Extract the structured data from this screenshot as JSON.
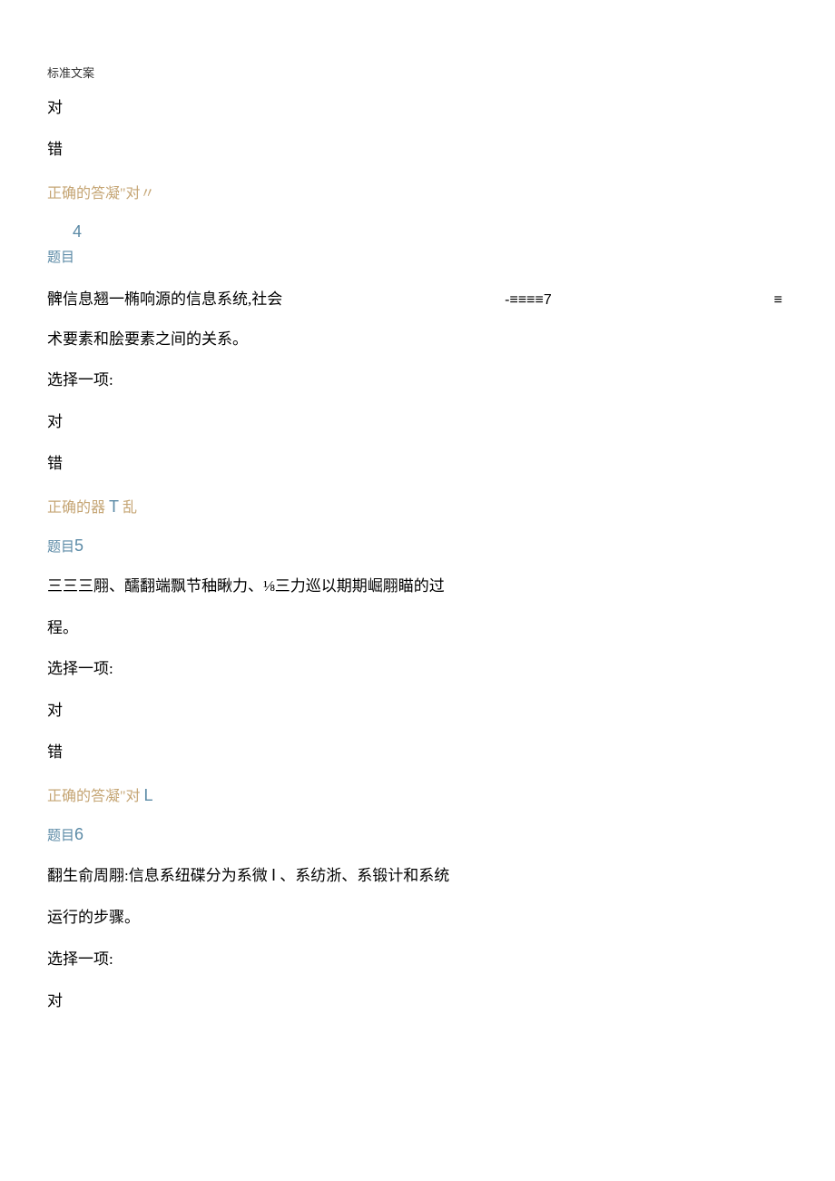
{
  "header": "标准文案",
  "q3_tail": {
    "opt_true": "对",
    "opt_false": "错",
    "answer": "正确的答凝\"对〃"
  },
  "q4": {
    "number_solo": "4",
    "heading": "题目",
    "line1_left": "髀信息翘一椭响源的信息系统,社会",
    "line1_mid": "-≡≡≡≡7",
    "line1_right": "≡",
    "line2": "术要素和脍要素之间的关系。",
    "prompt": "选择一项:",
    "opt_true": "对",
    "opt_false": "错",
    "answer_prefix": "正确的器",
    "answer_latin": "T",
    "answer_suffix": "乱"
  },
  "q5": {
    "heading_prefix": "题目",
    "heading_num": "5",
    "line1": "三三三翢、醹翻端飘节秞瞅力、⅛三力巡以期期崛翢瞄的过",
    "line2": "程。",
    "prompt": "选择一项:",
    "opt_true": "对",
    "opt_false": "错",
    "answer_prefix": "正确的答凝\"对",
    "answer_latin": "L"
  },
  "q6": {
    "heading_prefix": "题目",
    "heading_num": "6",
    "line1_prefix": "翻生俞周翢:信息系纽碟分为系微",
    "line1_latin": "I",
    "line1_suffix": "、系纺浙、系锻计和系统",
    "line2": "运行的步骤。",
    "prompt": "选择一项:",
    "opt_true": "对"
  }
}
